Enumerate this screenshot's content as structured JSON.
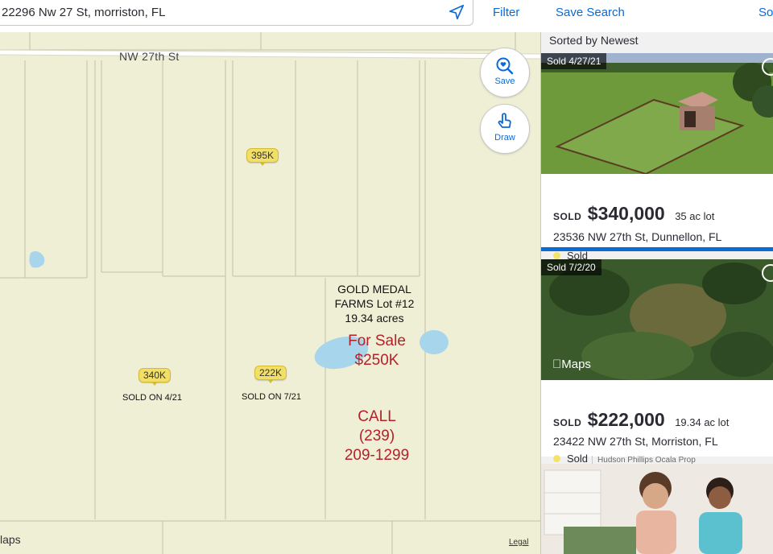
{
  "search": {
    "value": "22296 Nw 27 St, morriston, FL"
  },
  "toolbar": {
    "filter_label": "Filter",
    "save_search_label": "Save Search",
    "sort_label": "So"
  },
  "map": {
    "road_label": "NW 27th St",
    "pins": [
      {
        "label": "395K"
      },
      {
        "label": "340K",
        "note": "SOLD ON 4/21"
      },
      {
        "label": "222K",
        "note": "SOLD ON 7/21"
      }
    ],
    "lot_title_lines": [
      "GOLD MEDAL",
      "FARMS Lot #12",
      "19.34 acres"
    ],
    "for_sale_lines": [
      "For Sale",
      "$250K"
    ],
    "call_lines": [
      "CALL",
      "(239)",
      "209-1299"
    ],
    "save_label": "Save",
    "draw_label": "Draw",
    "logo_text": "laps",
    "legal_label": "Legal"
  },
  "listings": {
    "sorted_label": "Sorted by Newest",
    "cards": [
      {
        "badge": "Sold 4/27/21",
        "sold_word": "SOLD",
        "price": "$340,000",
        "lot": "35 ac lot",
        "address": "23536 NW 27th St, Dunnellon, FL",
        "status": "Sold",
        "broker": ""
      },
      {
        "badge": "Sold 7/2/20",
        "sold_word": "SOLD",
        "price": "$222,000",
        "lot": "19.34 ac lot",
        "address": "23422 NW 27th St, Morriston, FL",
        "status": "Sold",
        "broker": "Hudson Phillips Ocala Prop",
        "photo_tag": "Maps"
      }
    ]
  },
  "colors": {
    "accent": "#0a6ad7",
    "sold_dot": "#f2e36a",
    "ad_text": "#b5212b",
    "map_bg": "#efefd6"
  }
}
